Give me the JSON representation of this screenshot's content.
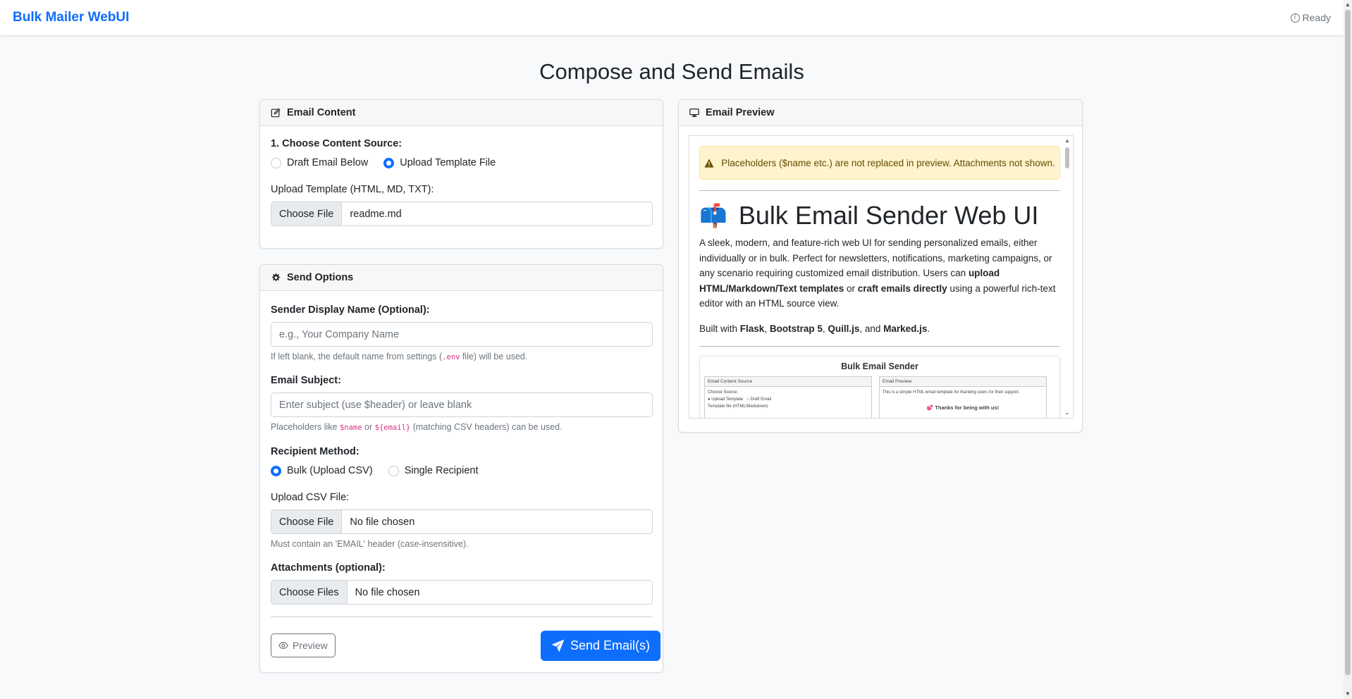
{
  "navbar": {
    "brand": "Bulk Mailer WebUI",
    "status": "Ready",
    "status_icon": "info-circle-icon"
  },
  "page": {
    "title": "Compose and Send Emails"
  },
  "email_content": {
    "header": "Email Content",
    "header_icon": "pencil-square-icon",
    "source_label": "1. Choose Content Source:",
    "source_options": [
      {
        "label": "Draft Email Below",
        "selected": false
      },
      {
        "label": "Upload Template File",
        "selected": true
      }
    ],
    "upload_label": "Upload Template (HTML, MD, TXT):",
    "choose_file_label": "Choose File",
    "file_name": "readme.md"
  },
  "send_options": {
    "header": "Send Options",
    "header_icon": "gear-icon",
    "sender_label": "Sender Display Name (Optional):",
    "sender_placeholder": "e.g., Your Company Name",
    "sender_hint_pre": "If left blank, the default name from settings (",
    "sender_hint_code": ".env",
    "sender_hint_post": " file) will be used.",
    "subject_label": "Email Subject:",
    "subject_placeholder": "Enter subject (use $header) or leave blank",
    "subject_hint_pre": "Placeholders like ",
    "subject_hint_code1": "$name",
    "subject_hint_mid": " or ",
    "subject_hint_code2": "${email}",
    "subject_hint_post": " (matching CSV headers) can be used.",
    "recipient_label": "Recipient Method:",
    "recipient_options": [
      {
        "label": "Bulk (Upload CSV)",
        "selected": true
      },
      {
        "label": "Single Recipient",
        "selected": false
      }
    ],
    "csv_label": "Upload CSV File:",
    "csv_choose": "Choose File",
    "csv_value": "No file chosen",
    "csv_hint": "Must contain an 'EMAIL' header (case-insensitive).",
    "attach_label": "Attachments (optional):",
    "attach_choose": "Choose Files",
    "attach_value": "No file chosen",
    "preview_button": "Preview",
    "preview_icon": "eye-icon",
    "send_button": "Send Email(s)",
    "send_icon": "send-plane-icon"
  },
  "email_preview": {
    "header": "Email Preview",
    "header_icon": "monitor-icon",
    "alert": "Placeholders ($name etc.) are not replaced in preview. Attachments not shown.",
    "alert_icon": "warning-triangle-icon",
    "heading_emoji": "📫",
    "heading": "Bulk Email Sender Web UI",
    "p1_a": "A sleek, modern, and feature-rich web UI for sending personalized emails, either individually or in bulk. Perfect for newsletters, notifications, marketing campaigns, or any scenario requiring customized email distribution. Users can ",
    "p1_b": "upload HTML/Markdown/Text templates",
    "p1_c": " or ",
    "p1_d": "craft emails directly",
    "p1_e": " using a powerful rich-text editor with an HTML source view.",
    "p2_a": "Built with ",
    "p2_b": "Flask",
    "p2_c": ", ",
    "p2_d": "Bootstrap 5",
    "p2_e": ", ",
    "p2_f": "Quill.js",
    "p2_g": ", and ",
    "p2_h": "Marked.js",
    "p2_i": ".",
    "shot": {
      "title": "Bulk Email Sender",
      "left_header": "Email Content Source",
      "left_line1": "Choose Source:",
      "left_opt1": "Upload Template",
      "left_opt2": "Draft Email",
      "left_line2": "Template file (HTML/Markdown):",
      "right_header": "Email Preview",
      "right_line1": "This is a simple HTML email template for thanking users for their support.",
      "right_line2": "💕 Thanks for being with us!"
    }
  }
}
